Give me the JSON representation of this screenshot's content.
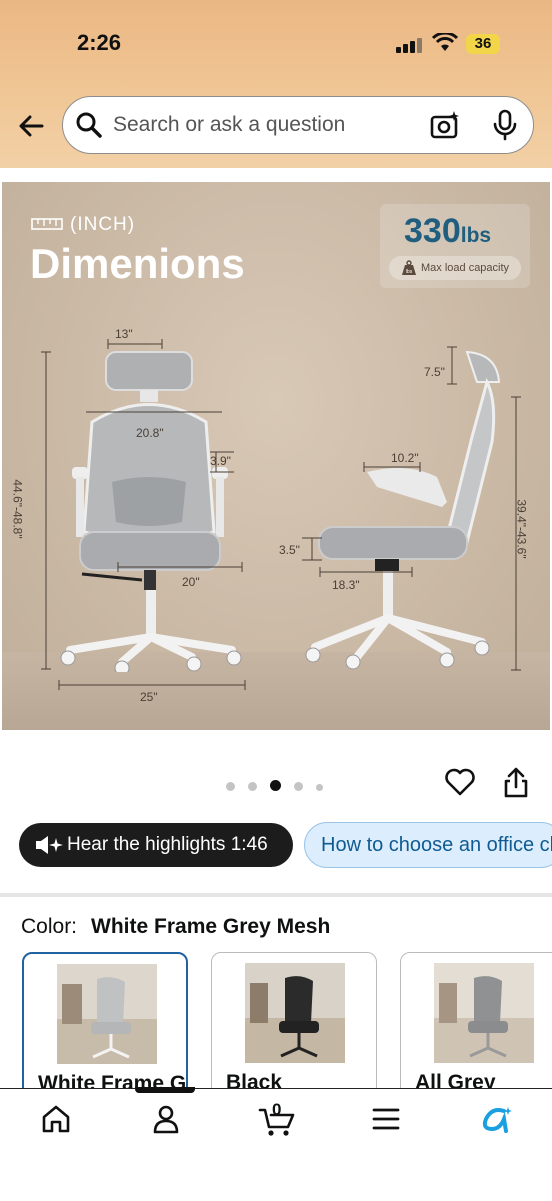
{
  "status_bar": {
    "time": "2:26",
    "battery": "36"
  },
  "search": {
    "placeholder": "Search or ask a question"
  },
  "product_image": {
    "unit_label": "(INCH)",
    "title": "Dimenions",
    "capacity": {
      "value": "330",
      "unit": "lbs",
      "badge_icon_text": "lbs",
      "label": "Max load capacity"
    },
    "dimensions": {
      "headrest_width": "13\"",
      "backrest_width": "20.8\"",
      "armrest_height": "3.9\"",
      "seat_width": "20\"",
      "base_width": "25\"",
      "front_height": "44.6\"-48.8\"",
      "headrest_height": "7.5\"",
      "armrest_length": "10.2\"",
      "seat_thickness": "3.5\"",
      "seat_depth": "18.3\"",
      "side_height": "39.4\"-43.6\""
    }
  },
  "carousel": {
    "count": 5,
    "active_index": 2
  },
  "chips": {
    "hear_label": "Hear the highlights 1:46",
    "guide_label": "How to choose an office chair"
  },
  "color": {
    "label": "Color:",
    "value": "White Frame Grey Mesh"
  },
  "swatches": [
    {
      "label": "White Frame Grey Mesh",
      "selected": true
    },
    {
      "label": "Black",
      "selected": false
    },
    {
      "label": "All Grey",
      "selected": false
    }
  ],
  "tabbar": {
    "cart_count": "0",
    "accent_color": "#1aa0e0"
  }
}
